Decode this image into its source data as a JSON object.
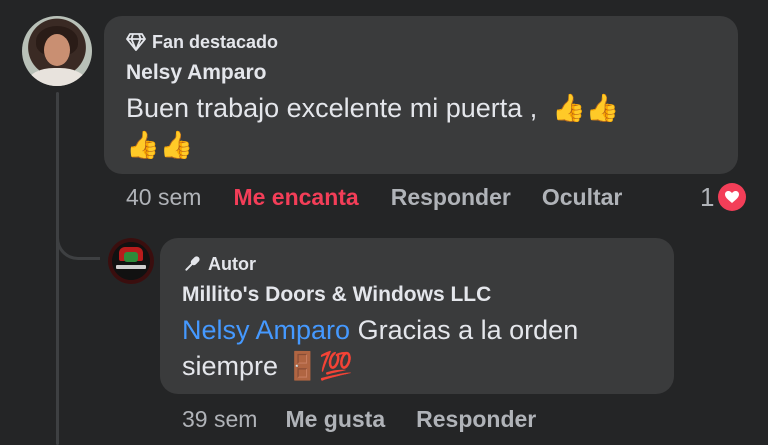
{
  "comment": {
    "badge": "Fan destacado",
    "badge_icon": "diamond-icon",
    "author": "Nelsy Amparo",
    "text_line1": "Buen trabajo excelente mi puerta ,",
    "emoji_line1": "👍👍",
    "emoji_line2": "👍👍",
    "time": "40 sem",
    "reaction_label": "Me encanta",
    "reply_label": "Responder",
    "hide_label": "Ocultar",
    "reaction_count": "1",
    "reaction_icon": "heart-icon",
    "colors": {
      "love": "#f33e58",
      "bubble": "#3a3b3c",
      "background": "#242526"
    }
  },
  "reply": {
    "badge": "Autor",
    "badge_icon": "microphone-icon",
    "author": "Millito's Doors & Windows LLC",
    "mention": "Nelsy Amparo",
    "text_rest": "Gracias a la orden",
    "text_line2": "siempre",
    "emoji": "🚪💯",
    "time": "39 sem",
    "like_label": "Me gusta",
    "reply_label": "Responder",
    "colors": {
      "mention": "#4599ff"
    }
  }
}
